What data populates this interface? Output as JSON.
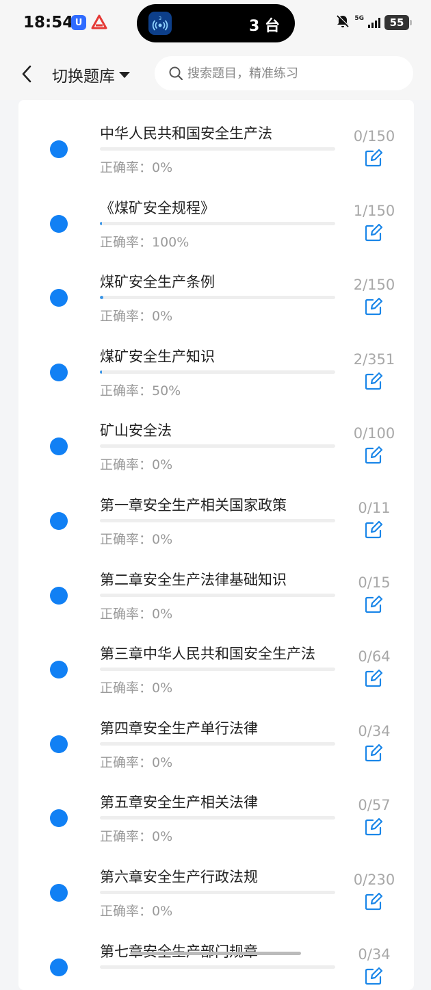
{
  "status_bar": {
    "time": "18:54",
    "notify_app_label": "U",
    "island_badge": "3",
    "island_text": "3 台",
    "network": "5G",
    "battery": "55"
  },
  "header": {
    "switch_bank_label": "切换题库",
    "search_placeholder": "搜索题目，精准练习"
  },
  "colors": {
    "accent": "#1180f4",
    "progress": "#3a95e6",
    "muted_text": "#9a9a9a"
  },
  "items": [
    {
      "title": "中华人民共和国安全生产法",
      "accuracy": "正确率：0%",
      "count": "0/150",
      "progress": 0.0
    },
    {
      "title": "《煤矿安全规程》",
      "accuracy": "正确率：100%",
      "count": "1/150",
      "progress": 0.0067
    },
    {
      "title": "煤矿安全生产条例",
      "accuracy": "正确率：0%",
      "count": "2/150",
      "progress": 0.0133
    },
    {
      "title": "煤矿安全生产知识",
      "accuracy": "正确率：50%",
      "count": "2/351",
      "progress": 0.0057
    },
    {
      "title": "矿山安全法",
      "accuracy": "正确率：0%",
      "count": "0/100",
      "progress": 0.0
    },
    {
      "title": "第一章安全生产相关国家政策",
      "accuracy": "正确率：0%",
      "count": "0/11",
      "progress": 0.0
    },
    {
      "title": "第二章安全生产法律基础知识",
      "accuracy": "正确率：0%",
      "count": "0/15",
      "progress": 0.0
    },
    {
      "title": "第三章中华人民共和国安全生产法",
      "accuracy": "正确率：0%",
      "count": "0/64",
      "progress": 0.0
    },
    {
      "title": "第四章安全生产单行法律",
      "accuracy": "正确率：0%",
      "count": "0/34",
      "progress": 0.0
    },
    {
      "title": "第五章安全生产相关法律",
      "accuracy": "正确率：0%",
      "count": "0/57",
      "progress": 0.0
    },
    {
      "title": "第六章安全生产行政法规",
      "accuracy": "正确率：0%",
      "count": "0/230",
      "progress": 0.0
    },
    {
      "title": "第七章安全生产部门规章",
      "accuracy": "",
      "count": "0/34",
      "progress": 0.0
    }
  ]
}
